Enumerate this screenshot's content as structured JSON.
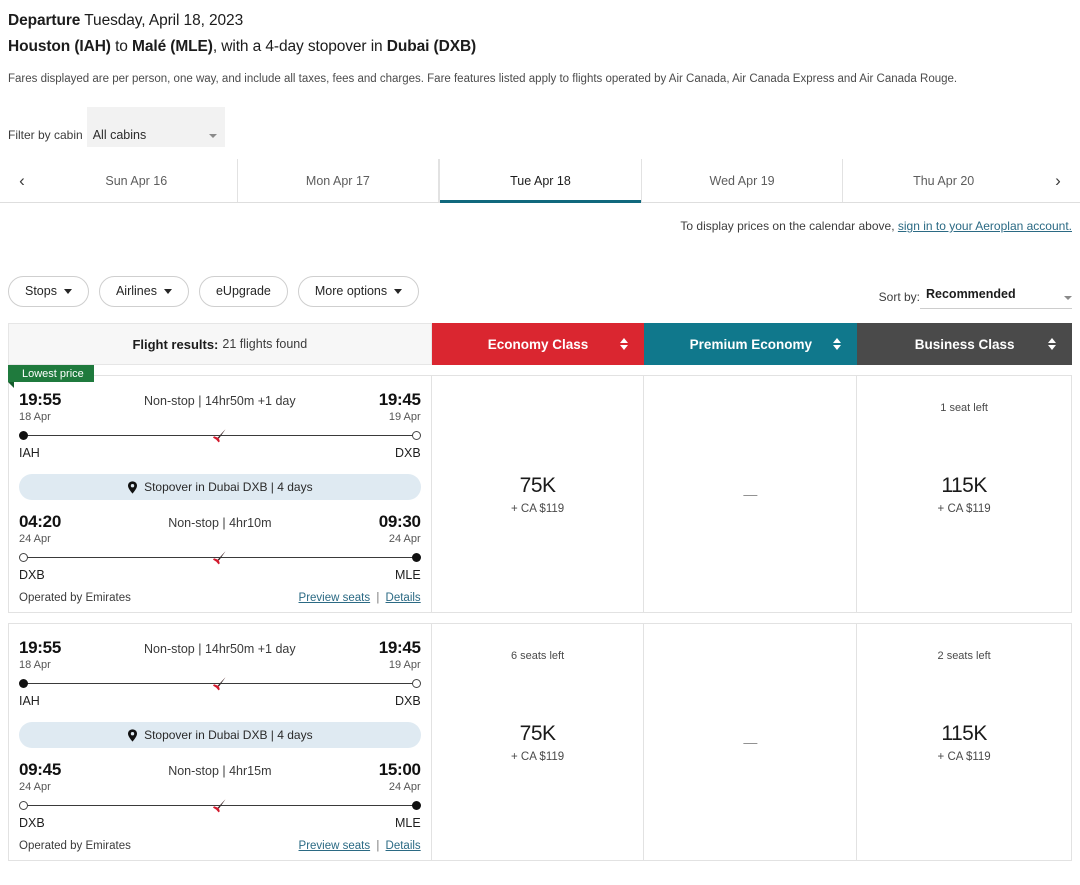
{
  "header": {
    "departure_label": "Departure",
    "departure_date": "Tuesday, April 18, 2023",
    "route_origin": "Houston (IAH)",
    "route_to": "to",
    "route_dest": "Malé (MLE)",
    "route_tail": ", with a 4-day stopover in",
    "route_stopover": "Dubai (DXB)",
    "fares_note": "Fares displayed are per person, one way, and include all taxes, fees and charges. Fare features listed apply to flights operated by Air Canada, Air Canada Express and Air Canada Rouge."
  },
  "cabin_filter": {
    "label": "Filter by cabin",
    "value": "All cabins",
    "caret_icon": "chevron-down-icon"
  },
  "calendar": {
    "prev_icon": "chevron-left-icon",
    "next_icon": "chevron-right-icon",
    "days": [
      {
        "label": "Sun Apr 16",
        "active": false
      },
      {
        "label": "Mon Apr 17",
        "active": false
      },
      {
        "label": "Tue Apr 18",
        "active": true
      },
      {
        "label": "Wed Apr 19",
        "active": false
      },
      {
        "label": "Thu Apr 20",
        "active": false
      }
    ],
    "signin_text": "To display prices on the calendar above,",
    "signin_link": "sign in to your Aeroplan account."
  },
  "filters": {
    "pills": [
      {
        "label": "Stops",
        "caret": true
      },
      {
        "label": "Airlines",
        "caret": true
      },
      {
        "label": "eUpgrade",
        "caret": false
      },
      {
        "label": "More options",
        "caret": true
      }
    ],
    "sort_label": "Sort by:",
    "sort_value": "Recommended",
    "sort_caret_icon": "chevron-down-icon"
  },
  "results_header": {
    "count_label": "Flight results:",
    "count_value": "21 flights found",
    "classes": [
      {
        "name": "Economy Class",
        "color": "#da2630"
      },
      {
        "name": "Premium Economy",
        "color": "#10788c"
      },
      {
        "name": "Business Class",
        "color": "#4a4a4a"
      }
    ],
    "sort_icon": "sort-updown-icon"
  },
  "flights": [
    {
      "badge": "Lowest price",
      "legs": [
        {
          "dep_time": "19:55",
          "dep_date": "18 Apr",
          "dep_code": "IAH",
          "info": "Non-stop | 14hr50m +1 day",
          "arr_time": "19:45",
          "arr_date": "19 Apr",
          "arr_code": "DXB",
          "start_dot": "solid",
          "end_dot": "hollow"
        },
        {
          "dep_time": "04:20",
          "dep_date": "24 Apr",
          "dep_code": "DXB",
          "info": "Non-stop | 4hr10m",
          "arr_time": "09:30",
          "arr_date": "24 Apr",
          "arr_code": "MLE",
          "start_dot": "hollow",
          "end_dot": "solid"
        }
      ],
      "stopover": "Stopover in Dubai DXB | 4 days",
      "stopover_icon": "map-pin-icon",
      "operated_by": "Operated by Emirates",
      "preview_link": "Preview seats",
      "details_link": "Details",
      "prices": [
        {
          "seats": "",
          "points": "75K",
          "cash": "+ CA $119",
          "unavailable": false
        },
        {
          "seats": "",
          "points": "",
          "cash": "",
          "unavailable": true
        },
        {
          "seats": "1 seat left",
          "points": "115K",
          "cash": "+ CA $119",
          "unavailable": false
        }
      ]
    },
    {
      "badge": "",
      "legs": [
        {
          "dep_time": "19:55",
          "dep_date": "18 Apr",
          "dep_code": "IAH",
          "info": "Non-stop | 14hr50m +1 day",
          "arr_time": "19:45",
          "arr_date": "19 Apr",
          "arr_code": "DXB",
          "start_dot": "solid",
          "end_dot": "hollow"
        },
        {
          "dep_time": "09:45",
          "dep_date": "24 Apr",
          "dep_code": "DXB",
          "info": "Non-stop | 4hr15m",
          "arr_time": "15:00",
          "arr_date": "24 Apr",
          "arr_code": "MLE",
          "start_dot": "hollow",
          "end_dot": "solid"
        }
      ],
      "stopover": "Stopover in Dubai DXB | 4 days",
      "stopover_icon": "map-pin-icon",
      "operated_by": "Operated by Emirates",
      "preview_link": "Preview seats",
      "details_link": "Details",
      "prices": [
        {
          "seats": "6 seats left",
          "points": "75K",
          "cash": "+ CA $119",
          "unavailable": false
        },
        {
          "seats": "",
          "points": "",
          "cash": "",
          "unavailable": true
        },
        {
          "seats": "2 seats left",
          "points": "115K",
          "cash": "+ CA $119",
          "unavailable": false
        }
      ]
    }
  ],
  "dash_symbol": "—"
}
